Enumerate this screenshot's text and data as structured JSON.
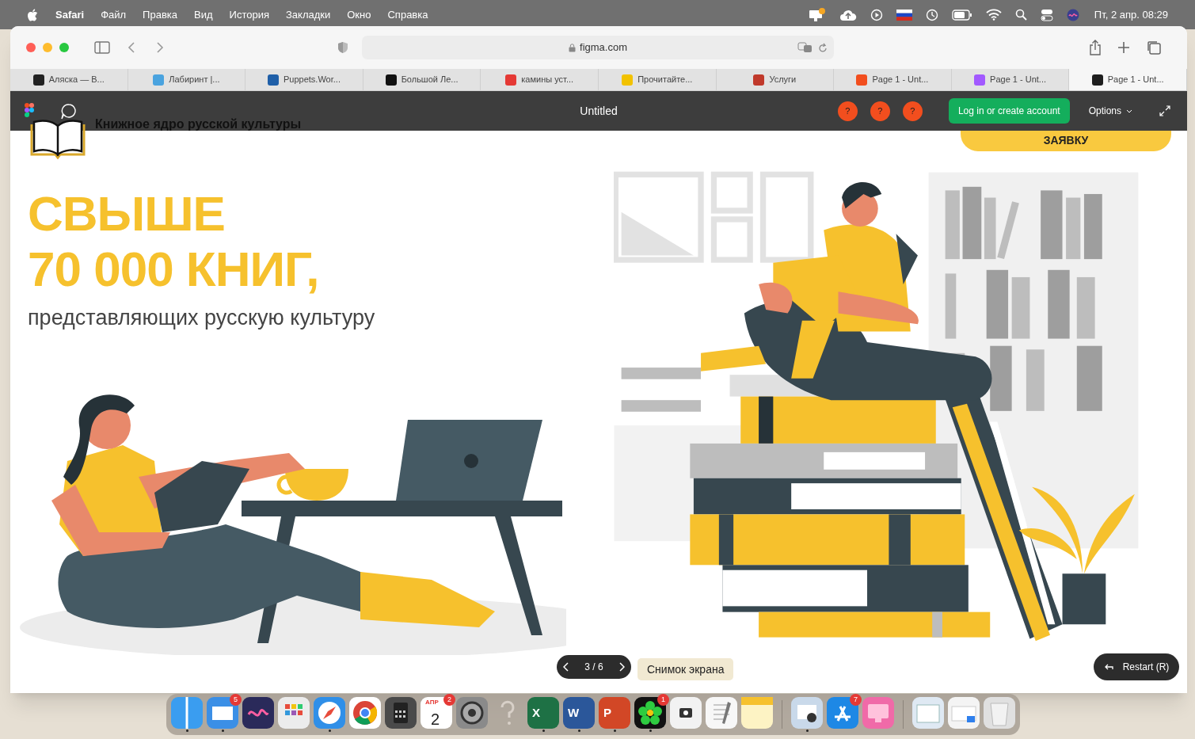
{
  "menu_bar": {
    "app": "Safari",
    "items": [
      "Файл",
      "Правка",
      "Вид",
      "История",
      "Закладки",
      "Окно",
      "Справка"
    ],
    "clock": "Пт, 2 апр. 08:29"
  },
  "toolbar": {
    "address": "figma.com"
  },
  "tabs": [
    {
      "label": "Аляска — В...",
      "color": "#222222",
      "selected": false
    },
    {
      "label": "Лабиринт |...",
      "color": "#4aa3df",
      "selected": false
    },
    {
      "label": "Puppets.Wor...",
      "color": "#1f5fa8",
      "selected": false
    },
    {
      "label": "Большой Ле...",
      "color": "#111111",
      "selected": false
    },
    {
      "label": "камины уст...",
      "color": "#e53935",
      "selected": false
    },
    {
      "label": "Прочитайте...",
      "color": "#f2c200",
      "selected": false
    },
    {
      "label": "Услуги",
      "color": "#c0392b",
      "selected": false
    },
    {
      "label": "Page 1 - Unt...",
      "color": "#f24e1e",
      "selected": false
    },
    {
      "label": "Page 1 - Unt...",
      "color": "#a259ff",
      "selected": false
    },
    {
      "label": "Page 1 - Unt...",
      "color": "#1e1e1e",
      "selected": true
    }
  ],
  "figma_bar": {
    "title": "Untitled",
    "viewers": [
      "?",
      "?",
      "?"
    ],
    "login": "Log in or create account",
    "options": "Options"
  },
  "page": {
    "site_title": "Книжное ядро русской культуры",
    "cta": "ЗАЯВКУ",
    "headline": [
      "СВЫШЕ",
      "70 000 КНИГ,"
    ],
    "subtitle": "представляющих русскую культуру"
  },
  "presentation": {
    "counter": "3 / 6",
    "tooltip": "Снимок экрана",
    "restart": "Restart (R)"
  },
  "dock": [
    {
      "kind": "finder",
      "running": true
    },
    {
      "kind": "mail",
      "badge": "5",
      "running": true
    },
    {
      "kind": "siri",
      "running": false
    },
    {
      "kind": "launchpad",
      "running": false
    },
    {
      "kind": "safari",
      "running": true
    },
    {
      "kind": "chrome",
      "running": false
    },
    {
      "kind": "calculator",
      "running": false
    },
    {
      "kind": "calendar",
      "month": "АПР",
      "day": "2",
      "badge": "2",
      "running": false
    },
    {
      "kind": "settings",
      "running": false
    },
    {
      "kind": "unknown",
      "running": false
    },
    {
      "kind": "excel",
      "letter": "X",
      "running": true
    },
    {
      "kind": "word",
      "letter": "W",
      "running": true
    },
    {
      "kind": "powerpoint",
      "letter": "P",
      "running": true
    },
    {
      "kind": "icq",
      "badge": "1",
      "running": true
    },
    {
      "kind": "screenshot",
      "running": false
    },
    {
      "kind": "textedit",
      "running": false
    },
    {
      "kind": "notes",
      "running": false
    },
    {
      "kind": "separator"
    },
    {
      "kind": "preview",
      "running": true
    },
    {
      "kind": "appstore",
      "badge": "7",
      "running": false
    },
    {
      "kind": "cleaner",
      "running": false
    },
    {
      "kind": "separator"
    },
    {
      "kind": "folder",
      "running": false
    },
    {
      "kind": "folder2",
      "running": false
    },
    {
      "kind": "trash",
      "running": false
    }
  ]
}
